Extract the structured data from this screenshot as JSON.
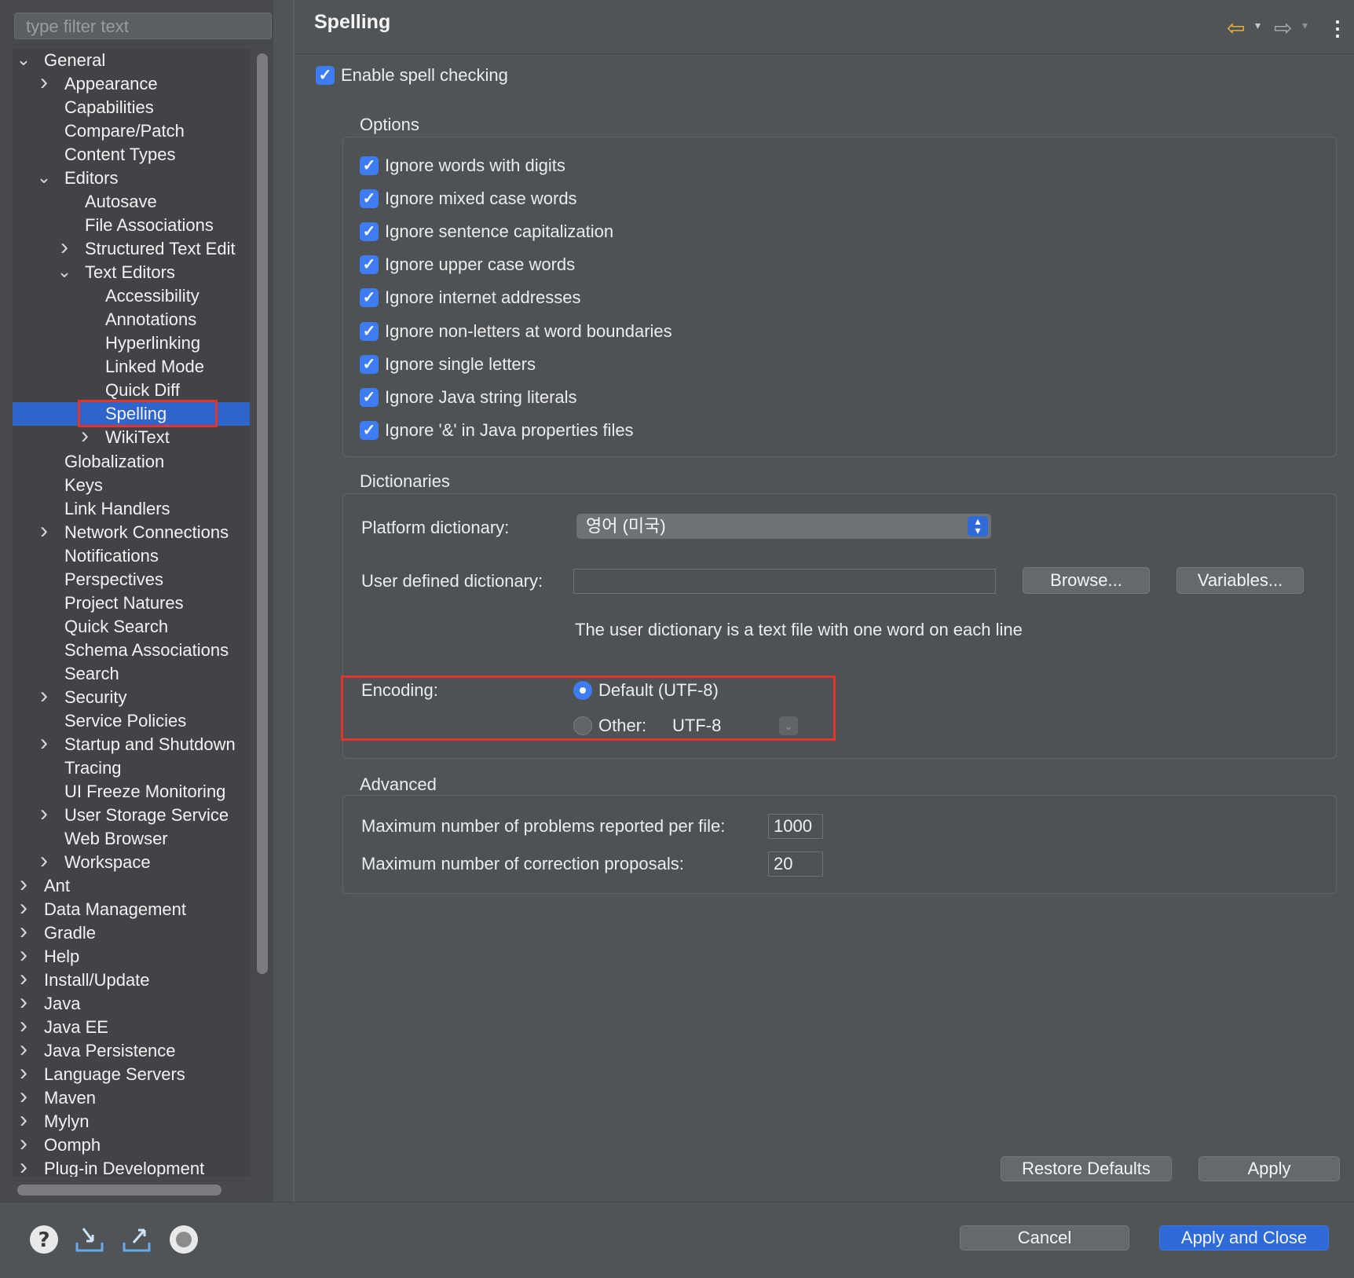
{
  "filter": {
    "placeholder": "type filter text"
  },
  "tree": [
    {
      "label": "General",
      "level": 0,
      "state": "expanded"
    },
    {
      "label": "Appearance",
      "level": 1,
      "state": "collapsed"
    },
    {
      "label": "Capabilities",
      "level": 1,
      "state": "leaf"
    },
    {
      "label": "Compare/Patch",
      "level": 1,
      "state": "leaf"
    },
    {
      "label": "Content Types",
      "level": 1,
      "state": "leaf"
    },
    {
      "label": "Editors",
      "level": 1,
      "state": "expanded"
    },
    {
      "label": "Autosave",
      "level": 2,
      "state": "leaf"
    },
    {
      "label": "File Associations",
      "level": 2,
      "state": "leaf"
    },
    {
      "label": "Structured Text Edit",
      "level": 2,
      "state": "collapsed"
    },
    {
      "label": "Text Editors",
      "level": 2,
      "state": "expanded"
    },
    {
      "label": "Accessibility",
      "level": 3,
      "state": "leaf"
    },
    {
      "label": "Annotations",
      "level": 3,
      "state": "leaf"
    },
    {
      "label": "Hyperlinking",
      "level": 3,
      "state": "leaf"
    },
    {
      "label": "Linked Mode",
      "level": 3,
      "state": "leaf"
    },
    {
      "label": "Quick Diff",
      "level": 3,
      "state": "leaf"
    },
    {
      "label": "Spelling",
      "level": 3,
      "state": "leaf",
      "selected": true
    },
    {
      "label": "WikiText",
      "level": 3,
      "state": "collapsed"
    },
    {
      "label": "Globalization",
      "level": 1,
      "state": "leaf"
    },
    {
      "label": "Keys",
      "level": 1,
      "state": "leaf"
    },
    {
      "label": "Link Handlers",
      "level": 1,
      "state": "leaf"
    },
    {
      "label": "Network Connections",
      "level": 1,
      "state": "collapsed"
    },
    {
      "label": "Notifications",
      "level": 1,
      "state": "leaf"
    },
    {
      "label": "Perspectives",
      "level": 1,
      "state": "leaf"
    },
    {
      "label": "Project Natures",
      "level": 1,
      "state": "leaf"
    },
    {
      "label": "Quick Search",
      "level": 1,
      "state": "leaf"
    },
    {
      "label": "Schema Associations",
      "level": 1,
      "state": "leaf"
    },
    {
      "label": "Search",
      "level": 1,
      "state": "leaf"
    },
    {
      "label": "Security",
      "level": 1,
      "state": "collapsed"
    },
    {
      "label": "Service Policies",
      "level": 1,
      "state": "leaf"
    },
    {
      "label": "Startup and Shutdown",
      "level": 1,
      "state": "collapsed"
    },
    {
      "label": "Tracing",
      "level": 1,
      "state": "leaf"
    },
    {
      "label": "UI Freeze Monitoring",
      "level": 1,
      "state": "leaf"
    },
    {
      "label": "User Storage Service",
      "level": 1,
      "state": "collapsed"
    },
    {
      "label": "Web Browser",
      "level": 1,
      "state": "leaf"
    },
    {
      "label": "Workspace",
      "level": 1,
      "state": "collapsed"
    },
    {
      "label": "Ant",
      "level": 0,
      "state": "collapsed"
    },
    {
      "label": "Data Management",
      "level": 0,
      "state": "collapsed"
    },
    {
      "label": "Gradle",
      "level": 0,
      "state": "collapsed"
    },
    {
      "label": "Help",
      "level": 0,
      "state": "collapsed"
    },
    {
      "label": "Install/Update",
      "level": 0,
      "state": "collapsed"
    },
    {
      "label": "Java",
      "level": 0,
      "state": "collapsed"
    },
    {
      "label": "Java EE",
      "level": 0,
      "state": "collapsed"
    },
    {
      "label": "Java Persistence",
      "level": 0,
      "state": "collapsed"
    },
    {
      "label": "Language Servers",
      "level": 0,
      "state": "collapsed"
    },
    {
      "label": "Maven",
      "level": 0,
      "state": "collapsed"
    },
    {
      "label": "Mylyn",
      "level": 0,
      "state": "collapsed"
    },
    {
      "label": "Oomph",
      "level": 0,
      "state": "collapsed"
    },
    {
      "label": "Plug-in Development",
      "level": 0,
      "state": "collapsed"
    }
  ],
  "page": {
    "title": "Spelling",
    "enable_spell_checking": {
      "label": "Enable spell checking",
      "checked": true
    }
  },
  "options": {
    "title": "Options",
    "items": [
      {
        "label": "Ignore words with digits",
        "checked": true
      },
      {
        "label": "Ignore mixed case words",
        "checked": true
      },
      {
        "label": "Ignore sentence capitalization",
        "checked": true
      },
      {
        "label": "Ignore upper case words",
        "checked": true
      },
      {
        "label": "Ignore internet addresses",
        "checked": true
      },
      {
        "label": "Ignore non-letters at word boundaries",
        "checked": true
      },
      {
        "label": "Ignore single letters",
        "checked": true
      },
      {
        "label": "Ignore Java string literals",
        "checked": true
      },
      {
        "label": "Ignore '&' in Java properties files",
        "checked": true
      }
    ]
  },
  "dictionaries": {
    "title": "Dictionaries",
    "platform_label": "Platform dictionary:",
    "platform_value": "영어 (미국)",
    "user_label": "User defined dictionary:",
    "user_value": "",
    "browse_label": "Browse...",
    "variables_label": "Variables...",
    "hint": "The user dictionary is a text file with one word on each line",
    "encoding_label": "Encoding:",
    "default_label": "Default (UTF-8)",
    "other_label": "Other:",
    "other_value": "UTF-8",
    "encoding_selected": "default"
  },
  "advanced": {
    "title": "Advanced",
    "max_problems_label": "Maximum number of problems reported per file:",
    "max_problems_value": "1000",
    "max_proposals_label": "Maximum number of correction proposals:",
    "max_proposals_value": "20"
  },
  "buttons": {
    "restore_defaults": "Restore Defaults",
    "apply": "Apply",
    "cancel": "Cancel",
    "apply_and_close": "Apply and Close"
  },
  "icons": {
    "back": "back-arrow-icon",
    "forward": "forward-arrow-icon",
    "menu": "kebab-menu-icon",
    "help": "help-icon",
    "import": "import-icon",
    "export": "export-icon",
    "record": "record-icon"
  },
  "colors": {
    "selection": "#2f65ca",
    "accent": "#3d7cf2",
    "highlight_box": "#e2362b",
    "back_arrow": "#f0b33a"
  }
}
